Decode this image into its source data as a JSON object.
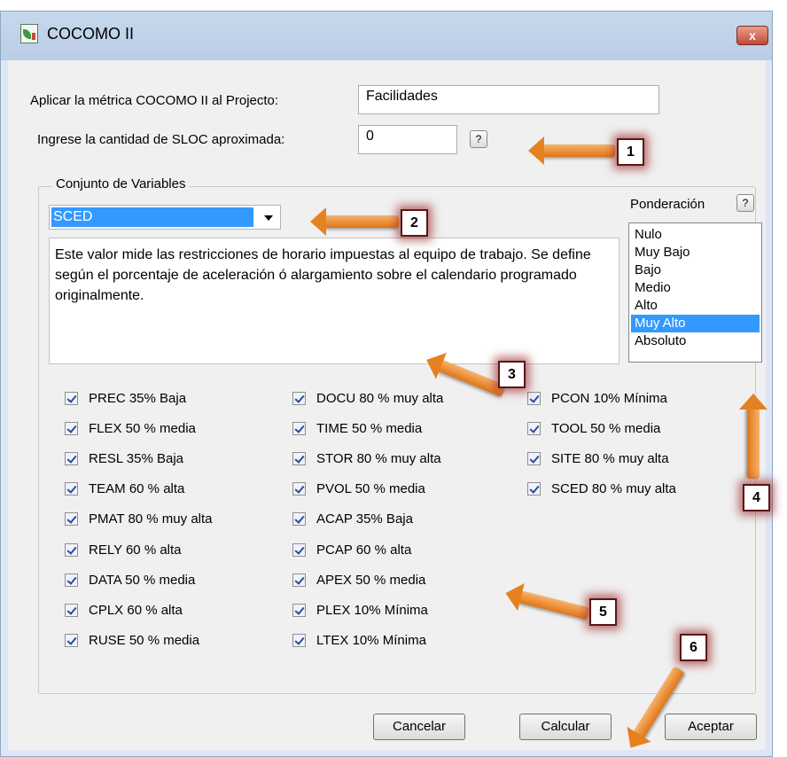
{
  "window": {
    "title": "COCOMO II",
    "close_label": "x"
  },
  "project": {
    "label": "Aplicar la métrica COCOMO II al  Projecto:",
    "value": "Facilidades"
  },
  "sloc": {
    "label": "Ingrese la cantidad de SLOC aproximada:",
    "value": "0",
    "help": "?"
  },
  "group": {
    "legend": "Conjunto de Variables"
  },
  "variable_select": {
    "selected": "SCED"
  },
  "description": "Este valor mide las restricciones de horario impuestas al equipo de trabajo. Se define según el porcentaje de aceleración ó alargamiento sobre el calendario programado originalmente.",
  "ponderacion": {
    "label": "Ponderación",
    "help": "?",
    "options": [
      "Nulo",
      "Muy Bajo",
      "Bajo",
      "Medio",
      "Alto",
      "Muy Alto",
      "Absoluto"
    ],
    "selected": "Muy Alto"
  },
  "checkboxes": {
    "col1": [
      "PREC 35% Baja",
      "FLEX 50 % media",
      "RESL 35% Baja",
      "TEAM 60 % alta",
      "PMAT 80 % muy alta",
      "RELY 60 % alta",
      "DATA 50 % media",
      "CPLX 60 % alta",
      "RUSE 50 % media"
    ],
    "col2": [
      "DOCU 80 % muy alta",
      "TIME 50 % media",
      "STOR 80 % muy alta",
      "PVOL 50 % media",
      "ACAP 35% Baja",
      "PCAP 60 % alta",
      "APEX 50 % media",
      "PLEX 10% Mínima",
      "LTEX 10% Mínima"
    ],
    "col3": [
      "PCON 10% Mínima",
      "TOOL 50 % media",
      "SITE 80 % muy alta",
      "SCED 80 % muy alta"
    ]
  },
  "buttons": {
    "cancel": "Cancelar",
    "calculate": "Calcular",
    "accept": "Aceptar"
  },
  "annotations": [
    "1",
    "2",
    "3",
    "4",
    "5",
    "6"
  ],
  "colors": {
    "arrow": "#e6811f",
    "selection": "#3399ff",
    "badge_glow": "#961e1e"
  }
}
